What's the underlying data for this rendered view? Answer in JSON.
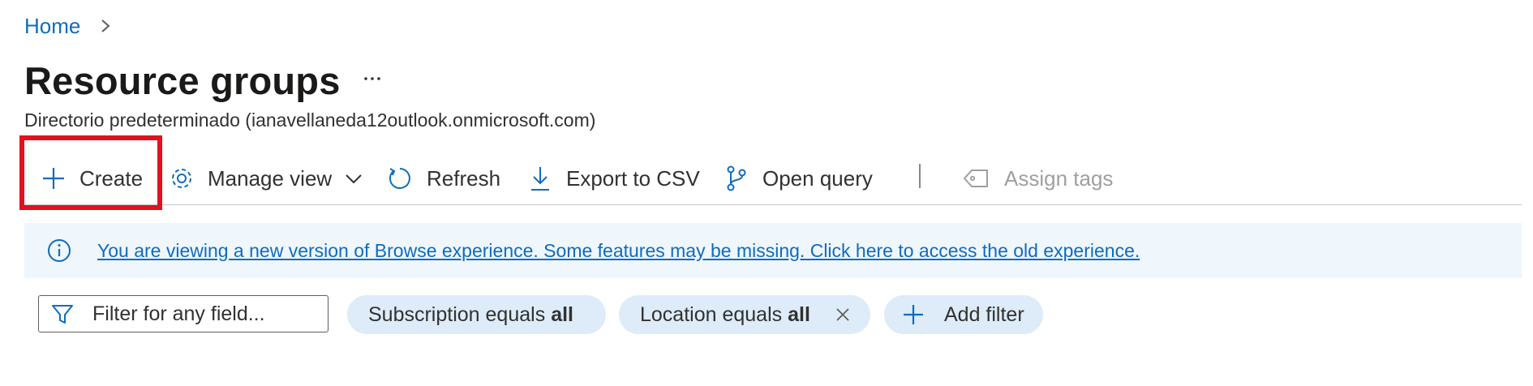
{
  "breadcrumb": {
    "home": "Home"
  },
  "page": {
    "title": "Resource groups",
    "subtitle": "Directorio predeterminado (ianavellaneda12outlook.onmicrosoft.com)"
  },
  "toolbar": {
    "create": "Create",
    "manage_view": "Manage view",
    "refresh": "Refresh",
    "export_csv": "Export to CSV",
    "open_query": "Open query",
    "assign_tags": "Assign tags"
  },
  "info_banner": {
    "text": "You are viewing a new version of Browse experience. Some features may be missing. Click here to access the old experience."
  },
  "filters": {
    "search_placeholder": "Filter for any field...",
    "subscription_label": "Subscription equals",
    "subscription_value": "all",
    "location_label": "Location equals",
    "location_value": "all",
    "add_filter": "Add filter"
  },
  "colors": {
    "accent": "#0f6cbd",
    "highlight_box": "#e3101e",
    "info_background": "#eff6fc",
    "pill_background": "#ddecf8"
  },
  "icons": [
    "chevron-right-icon",
    "more-icon",
    "plus-icon",
    "gear-icon",
    "chevron-down-icon",
    "refresh-icon",
    "download-icon",
    "branch-icon",
    "tag-icon",
    "info-icon",
    "funnel-icon",
    "close-icon"
  ]
}
